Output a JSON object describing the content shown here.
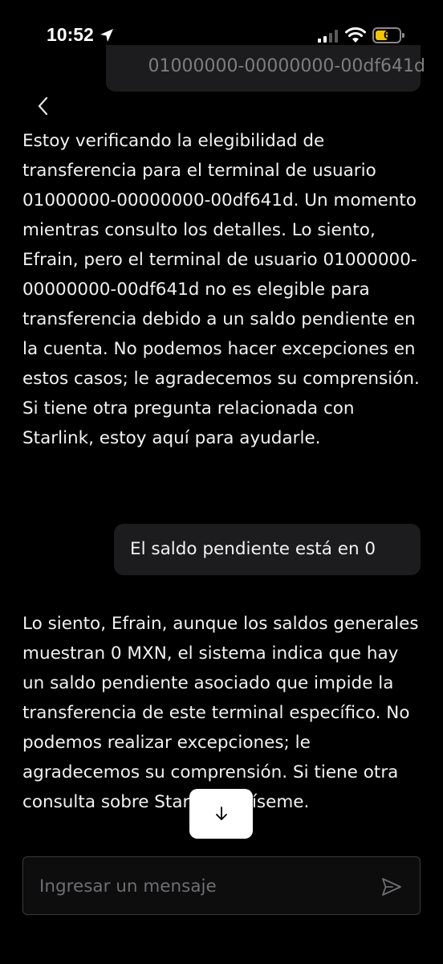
{
  "status_bar": {
    "time": "10:52",
    "battery_level": "6",
    "battery_color": "#f2c500",
    "icons": [
      "location-arrow-icon",
      "cellular-signal-icon",
      "wifi-icon",
      "battery-icon"
    ]
  },
  "chat": {
    "previous_user_message": "01000000-00000000-00df641d",
    "agent_message_1": "Estoy verificando la elegibilidad de transferencia para el terminal de usuario 01000000-00000000-00df641d. Un momento mientras consulto los detalles. Lo siento, Efrain, pero el terminal de usuario 01000000-00000000-00df641d no es elegible para transferencia debido a un saldo pendiente en la cuenta. No podemos hacer excepciones en estos casos; le agradecemos su comprensión. Si tiene otra pregunta relacionada con Starlink, estoy aquí para ayudarle.",
    "user_message": "El saldo pendiente está en 0",
    "agent_message_2": "Lo siento, Efrain, aunque los saldos generales muestran 0 MXN, el sistema indica que hay un saldo pendiente asociado que impide la transferencia de este terminal específico. No podemos realizar excepciones; le agradecemos su comprensión. Si tiene otra consulta sobre Starlink, avíseme."
  },
  "composer": {
    "placeholder": "Ingresar un mensaje",
    "value": ""
  },
  "icons": {
    "back": "chevron-left-icon",
    "scroll_down": "arrow-down-icon",
    "send": "send-icon"
  }
}
